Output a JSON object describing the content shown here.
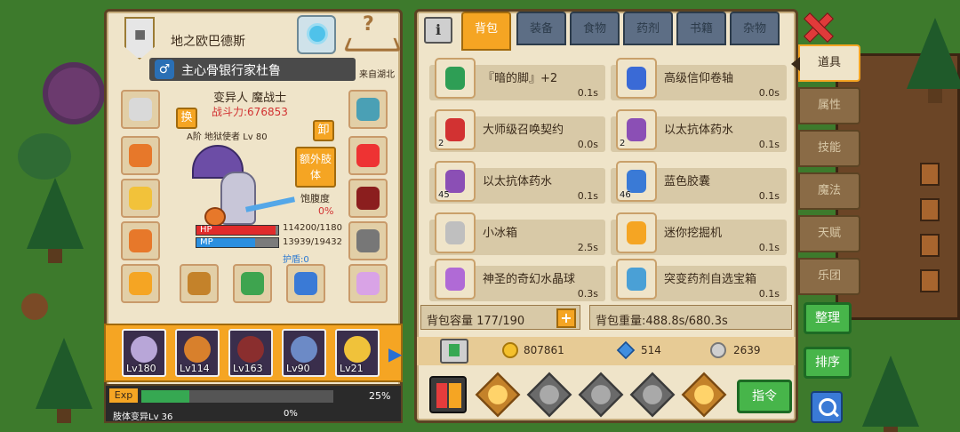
{
  "character": {
    "world_name": "地之欧巴德斯",
    "title": "主心骨银行家杜鲁",
    "gender_symbol": "♂",
    "origin": "来自湖北",
    "class": "变异人 魔战士",
    "power": "战斗力:676853",
    "level_line": "A阶 地狱使者 Lv 80",
    "swap_label": "换",
    "unequip_label": "卸",
    "extra_limb_label": "额外肢体",
    "satiety_label": "饱腹度",
    "satiety_value": "0%",
    "hp_label": "HP",
    "mp_label": "MP",
    "hp_value": "114200/1180",
    "mp_value": "13939/19432",
    "hp_fill": 0.97,
    "mp_fill": 0.72,
    "shield": "护盾:0",
    "equipment_slots": [
      {
        "name": "skull-helmet",
        "color": "#d9d9d9"
      },
      {
        "name": "serpent-amulet",
        "color": "#e7782a"
      },
      {
        "name": "eye-ring",
        "color": "#f2c23a"
      },
      {
        "name": "flame-armor",
        "color": "#e7782a"
      },
      {
        "name": "gold-belt",
        "color": "#f5a523"
      },
      {
        "name": "crystal-helm",
        "color": "#4aa0b5"
      },
      {
        "name": "red-flower",
        "color": "#e33"
      },
      {
        "name": "dark-cloak",
        "color": "#8b1e1e"
      },
      {
        "name": "gear-glove",
        "color": "#777"
      },
      {
        "name": "bunny-charm",
        "color": "#d9a3e6"
      },
      {
        "name": "staff",
        "color": "#c4822a"
      },
      {
        "name": "pumpkin-totem",
        "color": "#3ea44f"
      },
      {
        "name": "fish-blade",
        "color": "#3a7ad6"
      }
    ],
    "exp_label": "Exp",
    "exp_percent": "25%",
    "exp_fill": 0.25,
    "mutation_name": "肢体变异Lv 36",
    "mutation_percent": "0%"
  },
  "team": [
    {
      "level": "Lv180",
      "color": "#b8a6d8"
    },
    {
      "level": "Lv114",
      "color": "#d8802c"
    },
    {
      "level": "Lv163",
      "color": "#8a2e2e"
    },
    {
      "level": "Lv90",
      "color": "#6c8ac6"
    },
    {
      "level": "Lv21",
      "color": "#f0c23a"
    }
  ],
  "inventory": {
    "tabs": [
      {
        "label": "背包",
        "active": true
      },
      {
        "label": "装备",
        "active": false
      },
      {
        "label": "食物",
        "active": false
      },
      {
        "label": "药剂",
        "active": false
      },
      {
        "label": "书籍",
        "active": false
      },
      {
        "label": "杂物",
        "active": false
      }
    ],
    "items": [
      {
        "name": "『暗的脚』+2",
        "time": "0.1s",
        "count": "",
        "color": "#2e9e55"
      },
      {
        "name": "高级信仰卷轴",
        "time": "0.0s",
        "count": "",
        "color": "#3a6ad6"
      },
      {
        "name": "大师级召唤契约",
        "time": "0.0s",
        "count": "2",
        "color": "#d23232"
      },
      {
        "name": "以太抗体药水",
        "time": "0.1s",
        "count": "2",
        "color": "#8b4fb5"
      },
      {
        "name": "以太抗体药水",
        "time": "0.1s",
        "count": "45",
        "color": "#8b4fb5"
      },
      {
        "name": "蓝色胶囊",
        "time": "0.1s",
        "count": "46",
        "color": "#3a7ad6"
      },
      {
        "name": "小冰箱",
        "time": "2.5s",
        "count": "",
        "color": "#bfbfbf"
      },
      {
        "name": "迷你挖掘机",
        "time": "0.1s",
        "count": "",
        "color": "#f5a523"
      },
      {
        "name": "神圣的奇幻水晶球",
        "time": "0.3s",
        "count": "",
        "color": "#b06ad6"
      },
      {
        "name": "突变药剂自选宝箱",
        "time": "0.1s",
        "count": "",
        "color": "#4aa0d6"
      }
    ],
    "capacity": "背包容量 177/190",
    "capacity_plus": "+",
    "weight": "背包重量:488.8s/680.3s",
    "gold": "807861",
    "diamonds": "514",
    "silver": "2639",
    "command_label": "指令"
  },
  "side_tabs": [
    {
      "label": "道具",
      "active": true
    },
    {
      "label": "属性",
      "active": false
    },
    {
      "label": "技能",
      "active": false
    },
    {
      "label": "魔法",
      "active": false
    },
    {
      "label": "天赋",
      "active": false
    },
    {
      "label": "乐团",
      "active": false
    }
  ],
  "side_buttons": {
    "organize": "整理",
    "sort": "排序"
  }
}
